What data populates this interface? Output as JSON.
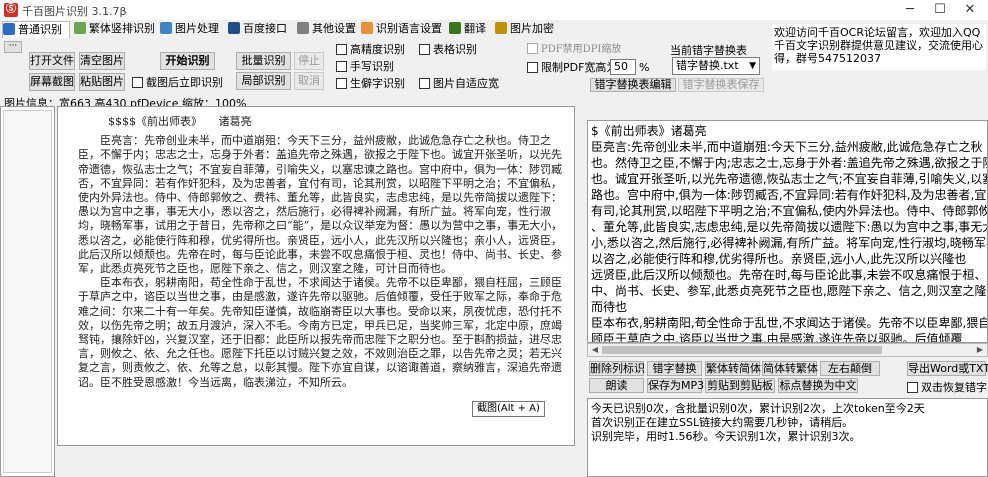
{
  "window": {
    "title": "千百图片识别 3.1.7β",
    "app_icon": "Ⓢ",
    "minimize": "─",
    "maximize": "☐",
    "close": "✕"
  },
  "tabs": [
    {
      "label": "普通识别",
      "icon": "#2b6cc4"
    },
    {
      "label": "繁体竖排识别",
      "icon": "#6aa84f"
    },
    {
      "label": "图片处理",
      "icon": "#3d85c6"
    },
    {
      "label": "百度接口",
      "icon": "#1f4e8c"
    },
    {
      "label": "其他设置",
      "icon": "#7f7f7f"
    },
    {
      "label": "识别语言设置",
      "icon": "#e69138"
    },
    {
      "label": "翻译",
      "icon": "#38761d"
    },
    {
      "label": "图片加密",
      "icon": "#bf9000"
    }
  ],
  "toolbar": {
    "more": "···",
    "open_file": "打开文件",
    "clear_image": "清空图片",
    "start_recognize": "开始识别",
    "batch_recognize": "批量识别",
    "stop": "停止",
    "screenshot": "屏幕截图",
    "paste_image": "粘贴图片",
    "recognize_after_capture": "截图后立即识别",
    "local_recognize": "局部识别",
    "cancel": "取消",
    "high_precision": "高精度识别",
    "handwriting": "手写识别",
    "rare_chars": "生僻字识别",
    "table_recognize": "表格识别",
    "auto_fit": "图片自适应宽",
    "pdf_dpi_scale": "PDF禁用DPI缩放",
    "limit_pdf_width": "限制PDF宽高为",
    "pdf_width_value": "50",
    "percent": "%",
    "typo_table_label": "当前错字替换表",
    "typo_table_select": "错字替换.txt",
    "typo_table_edit": "错字替换表编辑",
    "typo_table_save": "错字替换表保存"
  },
  "notice": "欢迎访问千百OCR论坛留言，欢迎加入QQ千百文字识别群提供意见建议，交流使用心得，群号547512037",
  "info": "图片信息：宽663 高430 pfDevice 缩放：100%",
  "source_doc": {
    "title": "$$$$《前出师表》　　诸葛亮",
    "paragraphs": [
      "臣亮言：先帝创业未半，而中道崩殂：今天下三分，益州疲敝，此诚危急存亡之秋也。侍卫之臣，不懈于内；忠志之士，忘身于外者：盖追先帝之殊遇，欲报之于陛下也。诚宜开张圣听，以光先帝遗德，恢弘志士之气；不宜妄自菲薄，引喻失义，以塞忠谏之路也。宫中府中，俱为一体：陟罚臧否，不宜异同：若有作奸犯科，及为忠善者，宜付有司，论其刑赏，以昭陛下平明之治；不宜偏私，使内外异法也。侍中、侍郎郭攸之、费祎、董允等，此皆良实，志虑忠纯，是以先帝简拔以遗陛下：愚以为宫中之事，事无大小，悉以咨之，然后施行，必得裨补阙漏，有所广益。将军向宠，性行淑均，晓畅军事，试用之于昔日，先帝称之曰“能”，是以众议举宠为督：愚以为营中之事，事无大小，悉以咨之，必能使行阵和穆，优劣得所也。亲贤臣，远小人，此先汉所以兴隆也；亲小人，远贤臣，此后汉所以倾颓也。先帝在时，每与臣论此事，未尝不叹息痛恨于桓、灵也！侍中、尚书、长史、参军，此悉贞亮死节之臣也，愿陛下亲之、信之，则汉室之隆，可计日而待也。",
      "臣本布衣，躬耕南阳，苟全性命于乱世，不求闻达于诸侯。先帝不以臣卑鄙，猥自枉屈，三顾臣于草庐之中，谘臣以当世之事，由是感激，遂许先帝以驱驰。后值倾覆，受任于败军之际，奉命于危难之间：尔来二十有一年矣。先帝知臣谨慎，故临崩寄臣以大事也。受命以来，夙夜忧虑，恐付托不效，以伤先帝之明；故五月渡泸，深入不毛。今南方已定，甲兵已足，当奖帅三军，北定中原，庶竭驽钝，攘除奸凶，兴复汉室，还于旧都：此臣所以报先帝而忠陛下之职分也。至于斟酌损益，进尽忠言，则攸之、依、允之任也。愿陛下托臣以讨贼兴复之效，不效则治臣之罪，以告先帝之灵；若无兴复之言，则责攸之、依、允等之怠，以彰其慢。陛下亦宜自谋，以谘诹善道，察纳雅言，深追先帝遗诏。臣不胜受恩感激！今当远离，临表涕泣，不知所云。"
    ]
  },
  "tooltip": "截图(Alt + A)",
  "result_lines": [
    "$《前出师表》诸葛亮",
    "臣亮言:先帝创业未半,而中道崩殂:今天下三分,益州疲敝,此诚危急存亡之秋",
    "也。然侍卫之臣,不懈于内;忠志之士,忘身于外者:盖追先帝之殊遇,欲报之于陛下",
    "也。诚宜开张圣听,以光先帝遗德,恢弘志士之气;不宜妄自菲薄,引喻失义,以塞忠谏之",
    "路也。宫中府中,俱为一体:陟罚臧否,不宜异同:若有作奸犯科,及为忠善者,宜付",
    "有司,论其刑赏,以昭陛下平明之治;不宜偏私,使内外异法也。侍中、侍郎郭攸之、费祎",
    "、董允等,此皆良实,志虑忠纯,是以先帝简拔以遗陛下:愚以为宫中之事,事无大",
    "小,悉以咨之,然后施行,必得裨补阙漏,有所广益。将军向宠,性行淑均,晓畅军事",
    "以咨之,必能使行阵和穆,优劣得所也。亲贤臣,远小人,此先汉所以兴隆也",
    "远贤臣,此后汉所以倾颓也。先帝在时,每与臣论此事,未尝不叹息痛恨于桓、灵也",
    "中、尚书、长史、参军,此悉贞亮死节之臣也,愿陛下亲之、信之,则汉室之隆",
    "而待也",
    "臣本布衣,躬耕南阳,苟全性命于乱世,不求闻达于诸侯。先帝不以臣卑鄙,猥自枉屈",
    "顾臣于草庐之中,谘臣以当世之事,由是感激,遂许先帝以驱驰。后值倾覆"
  ],
  "actions": {
    "delete_newlines": "删除列标识",
    "typo_replace": "错字替换",
    "trad_to_simp": "繁体转简体",
    "simp_to_trad": "简体转繁体",
    "swap_lr": "左右颠倒",
    "export_word": "导出Word或TXT",
    "read_aloud": "朗读",
    "save_mp3": "保存为MP3",
    "cut_to_clipboard": "剪贴到剪贴板",
    "punct_to_chinese": "标点替换为中文",
    "double_click_restore": "双击恢复错字"
  },
  "log_lines": [
    "今天已识别0次，含批量识别0次，累计识别2次，上次token至今2天",
    "首次识别正在建立SSL链接大约需要几秒钟，请稍后。",
    "识别完毕，用时1.56秒。今天识别1次，累计识别3次。"
  ]
}
